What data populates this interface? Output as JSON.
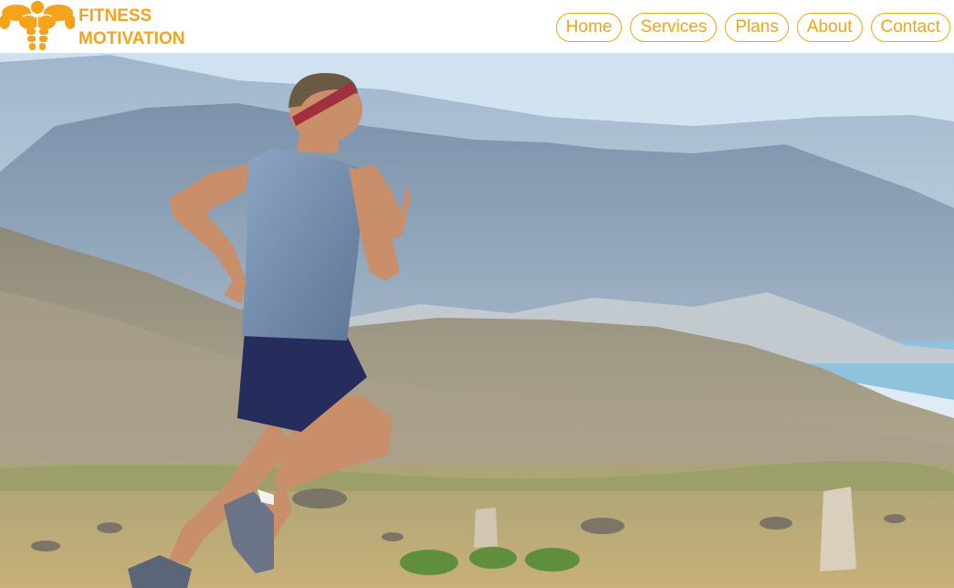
{
  "header": {
    "brand_line1": "FITNESS",
    "brand_line2": "MOTIVATION",
    "logo_icon": "muscle-torso-icon",
    "accent_color": "#f5a31a"
  },
  "nav": {
    "items": [
      {
        "label": "Home"
      },
      {
        "label": "Services"
      },
      {
        "label": "Plans"
      },
      {
        "label": "About"
      },
      {
        "label": "Contact"
      }
    ]
  },
  "hero": {
    "image": "runner-on-mountain-road-photo",
    "colors": {
      "sky": "#d9e8f3",
      "far_mountains": "#8fa9c4",
      "near_mountains": "#a7b2c0",
      "hills": "#a59d86",
      "lake": "#8fc3dd",
      "field": "#b7a96a"
    }
  }
}
